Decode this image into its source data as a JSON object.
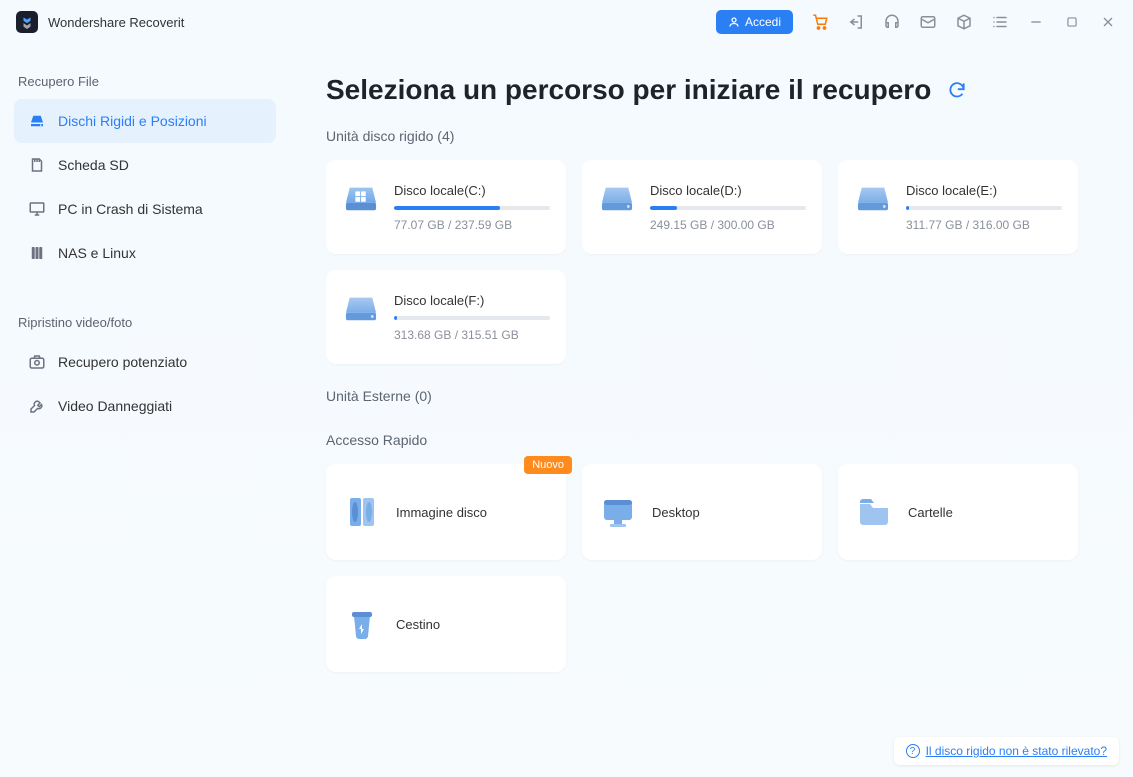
{
  "app": {
    "title": "Wondershare Recoverit"
  },
  "titlebar": {
    "login_label": "Accedi"
  },
  "sidebar": {
    "section1_title": "Recupero File",
    "section2_title": "Ripristino video/foto",
    "items1": [
      {
        "label": "Dischi Rigidi e Posizioni",
        "active": true,
        "icon": "disk"
      },
      {
        "label": "Scheda SD",
        "active": false,
        "icon": "sd"
      },
      {
        "label": "PC in Crash di Sistema",
        "active": false,
        "icon": "monitor"
      },
      {
        "label": "NAS e Linux",
        "active": false,
        "icon": "nas"
      }
    ],
    "items2": [
      {
        "label": "Recupero potenziato",
        "icon": "camera"
      },
      {
        "label": "Video Danneggiati",
        "icon": "wrench"
      }
    ]
  },
  "main": {
    "title": "Seleziona un percorso per iniziare il recupero",
    "hdd_header": "Unità disco rigido (4)",
    "external_header": "Unità Esterne (0)",
    "quick_header": "Accesso Rapido",
    "drives": [
      {
        "name": "Disco locale(C:)",
        "meta": "77.07 GB / 237.59 GB",
        "pct": 68,
        "type": "win"
      },
      {
        "name": "Disco locale(D:)",
        "meta": "249.15 GB / 300.00 GB",
        "pct": 17,
        "type": "hdd"
      },
      {
        "name": "Disco locale(E:)",
        "meta": "311.77 GB / 316.00 GB",
        "pct": 2,
        "type": "hdd"
      },
      {
        "name": "Disco locale(F:)",
        "meta": "313.68 GB / 315.51 GB",
        "pct": 2,
        "type": "hdd"
      }
    ],
    "quick": [
      {
        "name": "Immagine disco",
        "icon": "diskimage",
        "badge": "Nuovo"
      },
      {
        "name": "Desktop",
        "icon": "desktop"
      },
      {
        "name": "Cartelle",
        "icon": "folder"
      },
      {
        "name": "Cestino",
        "icon": "trash"
      }
    ]
  },
  "help": {
    "text": "Il disco rigido non è stato rilevato?"
  }
}
